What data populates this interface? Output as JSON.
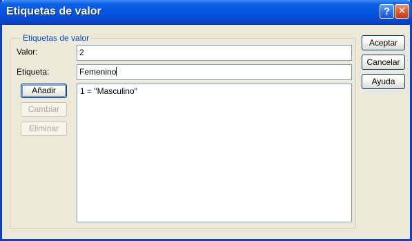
{
  "window": {
    "title": "Etiquetas de valor",
    "help_glyph": "?",
    "close_glyph": "✕"
  },
  "group": {
    "legend": "Etiquetas de valor"
  },
  "fields": {
    "value_label": "Valor:",
    "value_text": "2",
    "tag_label": "Etiqueta:",
    "tag_text": "Femenino"
  },
  "buttons": {
    "add": "Añadir",
    "change": "Cambiar",
    "delete": "Eliminar",
    "accept": "Aceptar",
    "cancel": "Cancelar",
    "help": "Ayuda"
  },
  "list": {
    "items": [
      "1 = \"Masculino\""
    ]
  },
  "colors": {
    "titlebar": "#0854e0",
    "window_bg": "#ece9d8",
    "group_legend": "#0046d5",
    "field_border": "#7f9db9"
  }
}
